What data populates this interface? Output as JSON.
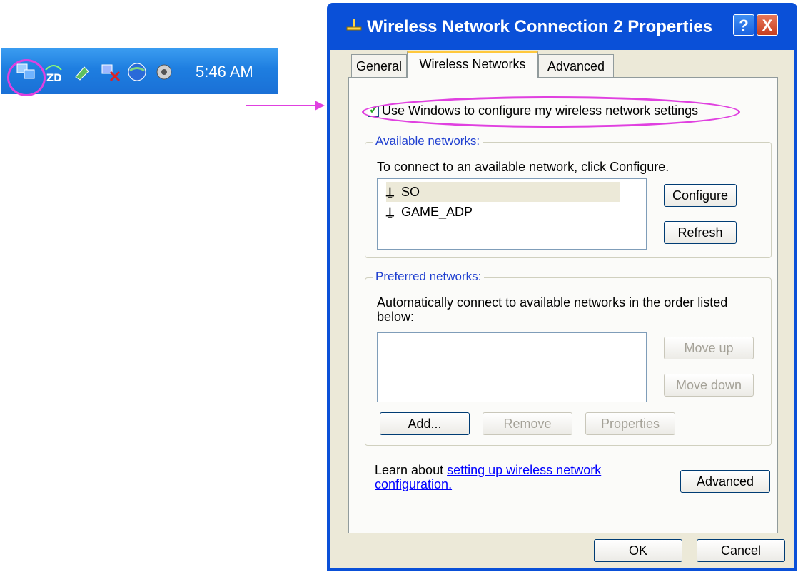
{
  "taskbar": {
    "time": "5:46 AM"
  },
  "dialog": {
    "title": "Wireless Network Connection 2 Properties",
    "help_btn": "?",
    "close_btn": "X",
    "tabs": [
      "General",
      "Wireless Networks",
      "Advanced"
    ],
    "active_tab": "Wireless Networks",
    "use_windows_checkbox": {
      "label": "Use Windows to configure my wireless network settings",
      "checked": true
    },
    "available": {
      "label": "Available networks:",
      "description": "To connect to an available network, click Configure.",
      "networks": [
        "SO",
        "GAME_ADP"
      ],
      "selected": "SO",
      "configure_btn": "Configure",
      "refresh_btn": "Refresh"
    },
    "preferred": {
      "label": "Preferred networks:",
      "description": "Automatically connect to available networks in the order listed below:",
      "move_up_btn": "Move up",
      "move_down_btn": "Move down",
      "add_btn": "Add...",
      "remove_btn": "Remove",
      "properties_btn": "Properties"
    },
    "learn_text": "Learn about",
    "learn_link": "setting up wireless network configuration.",
    "advanced_btn": "Advanced",
    "ok_btn": "OK",
    "cancel_btn": "Cancel"
  },
  "colors": {
    "annotation": "#e040e0",
    "title_bar": "#0a50d8",
    "tab_highlight": "#ffc83c"
  }
}
